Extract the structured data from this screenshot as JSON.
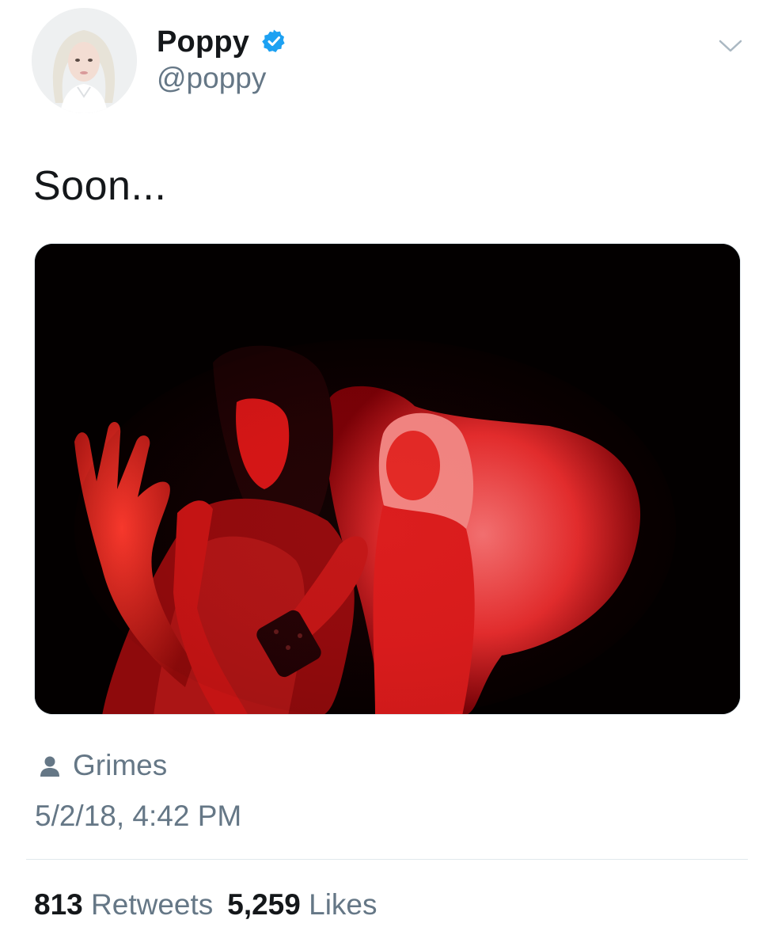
{
  "user": {
    "display_name": "Poppy",
    "handle": "@poppy",
    "verified_icon": "verified-badge-icon",
    "avatar_icon": "profile-avatar"
  },
  "menu_icon": "chevron-down-icon",
  "tweet": {
    "text": "Soon...",
    "media_description": "photo",
    "tagged_person": "Grimes",
    "tagged_icon": "person-icon",
    "timestamp": "5/2/18, 4:42 PM"
  },
  "stats": {
    "retweets_count": "813",
    "retweets_label": "Retweets",
    "likes_count": "5,259",
    "likes_label": "Likes"
  },
  "colors": {
    "accent": "#1da1f2",
    "secondary_text": "#657786",
    "primary_text": "#14171a",
    "divider": "#e1e8ed"
  }
}
